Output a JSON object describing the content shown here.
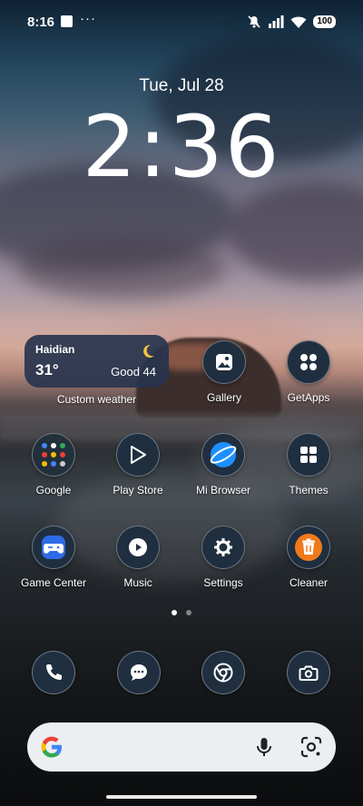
{
  "status_bar": {
    "time": "8:16",
    "more": "···",
    "battery": "100"
  },
  "lock": {
    "date": "Tue, Jul 28",
    "clock": "2:36"
  },
  "weather_widget": {
    "city": "Haidian",
    "temperature": "31°",
    "air_quality": "Good 44",
    "label": "Custom weather"
  },
  "apps": [
    {
      "label": "Gallery",
      "icon": "gallery-icon"
    },
    {
      "label": "GetApps",
      "icon": "getapps-icon"
    },
    {
      "label": "Google",
      "icon": "google-folder-icon"
    },
    {
      "label": "Play Store",
      "icon": "play-store-icon"
    },
    {
      "label": "Mi Browser",
      "icon": "mi-browser-icon"
    },
    {
      "label": "Themes",
      "icon": "themes-icon"
    },
    {
      "label": "Game Center",
      "icon": "game-center-icon"
    },
    {
      "label": "Music",
      "icon": "music-icon"
    },
    {
      "label": "Settings",
      "icon": "settings-icon"
    },
    {
      "label": "Cleaner",
      "icon": "cleaner-icon"
    }
  ],
  "page_indicator": {
    "pages": 2,
    "current": 1
  },
  "dock": [
    {
      "icon": "phone-icon"
    },
    {
      "icon": "messages-icon"
    },
    {
      "icon": "chrome-icon"
    },
    {
      "icon": "camera-icon"
    }
  ],
  "search": {
    "icons": [
      "google-g-icon",
      "microphone-icon",
      "lens-icon"
    ]
  },
  "colors": {
    "widget_bg": "#28344E",
    "icon_bg": "#1F2F40",
    "cleaner": "#F07A1A",
    "game_center": "#2E6BE6",
    "browser": "#1E8FFF"
  }
}
